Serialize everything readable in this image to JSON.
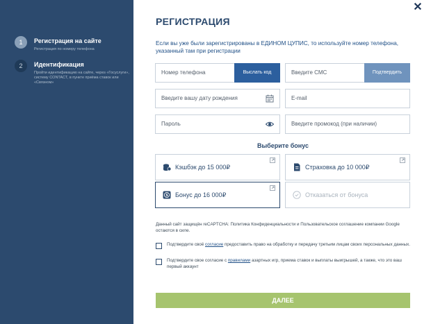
{
  "sidebar": {
    "steps": [
      {
        "num": "1",
        "title": "Регистрация на сайте",
        "desc": "Регистрация по номеру телефона"
      },
      {
        "num": "2",
        "title": "Идентификация",
        "desc": "Пройти идентификацию на сайте, через «Госуслуги», систему CONTACT, в пункте приёма ставок или «Связном»"
      }
    ]
  },
  "close_label": "✕",
  "title": "РЕГИСТРАЦИЯ",
  "intro": "Если вы уже были зарегистрированы в ЕДИНОМ ЦУПИС, то используйте номер телефона, указанный там при регистрации",
  "form": {
    "phone_placeholder": "Номер телефона",
    "send_code_label": "Выслать код",
    "sms_placeholder": "Введите СМС",
    "confirm_label": "Подтвердить",
    "birthdate_placeholder": "Введите вашу дату рождения",
    "email_placeholder": "E-mail",
    "password_placeholder": "Пароль",
    "promo_placeholder": "Введите промокод (при наличии)"
  },
  "bonus": {
    "heading": "Выберите бонус",
    "options": [
      {
        "label": "Кэшбэк до 15 000₽",
        "icon": "coins-icon"
      },
      {
        "label": "Страховка до 10 000₽",
        "icon": "document-icon"
      },
      {
        "label": "Бонус до 16 000₽",
        "icon": "dollar-icon",
        "selected": true
      },
      {
        "label": "Отказаться от бонуса",
        "icon": "decline-icon",
        "disabled": true
      }
    ]
  },
  "recaptcha": "Данный сайт защищён reCAPTCHA: Политика Конфиденциальности и Пользовательское соглашение компании Google остаются в силе.",
  "consent1": {
    "before": "Подтвердите своё ",
    "link": "согласие",
    "after": " предоставить право на обработку и передачу третьим лицам своих персональных данных."
  },
  "consent2": {
    "before": "Подтвердите свое согласие с ",
    "link": "правилами",
    "after": " азартных игр, приема ставок и выплаты выигрышей, а также, что это ваш первый аккаунт"
  },
  "submit_label": "ДАЛЕЕ",
  "colors": {
    "sidebar": "#2c4a6e",
    "primary_button": "#2c5f9e",
    "secondary_button": "#6f93bd",
    "submit": "#a6c46e"
  }
}
